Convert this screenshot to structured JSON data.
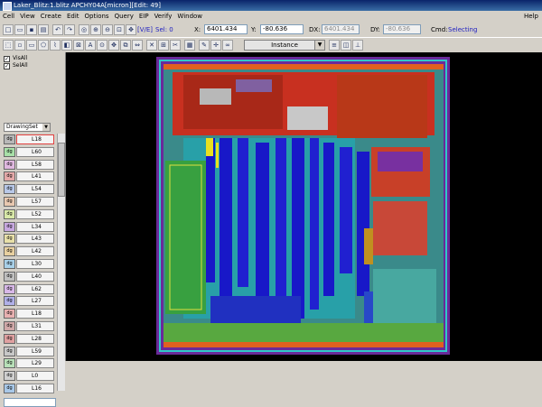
{
  "window": {
    "title": "Laker_Blitz:1.blitz APCHY04A[micron][Edit: 49]"
  },
  "menu": {
    "items": [
      "Cell",
      "View",
      "Create",
      "Edit",
      "Options",
      "Query",
      "EIP",
      "Verify",
      "Window"
    ],
    "help": "Help"
  },
  "toolbar": {
    "ve_label": "[V/E]",
    "sel_label": "Sel: 0",
    "x_label": "X:",
    "x_value": "6401.434",
    "y_label": "Y:",
    "y_value": "-80.636",
    "dx_label": "DX:",
    "dx_value": "6401.434",
    "dy_label": "DY:",
    "dy_value": "-80.636",
    "cmd_label": "Cmd:",
    "cmd_value": "Selecting",
    "instance_select": "Instance"
  },
  "left_panel": {
    "vis_all": "VisAll",
    "sel_all": "SelAll",
    "drawing_set": "DrawingSet",
    "layers": [
      {
        "label": "dg",
        "name": "L18",
        "color": "#b8b8b8"
      },
      {
        "label": "dg",
        "name": "L60",
        "color": "#a8e0a8"
      },
      {
        "label": "dg",
        "name": "L58",
        "color": "#e0b8e0"
      },
      {
        "label": "dg",
        "name": "L41",
        "color": "#e4a8a8"
      },
      {
        "label": "dg",
        "name": "L54",
        "color": "#b8c8e8"
      },
      {
        "label": "dg",
        "name": "L57",
        "color": "#e8c8b0"
      },
      {
        "label": "dg",
        "name": "L52",
        "color": "#d8e8a8"
      },
      {
        "label": "dg",
        "name": "L34",
        "color": "#c8a8e0"
      },
      {
        "label": "dg",
        "name": "L43",
        "color": "#e8e0a8"
      },
      {
        "label": "dg",
        "name": "L42",
        "color": "#e8d0a0"
      },
      {
        "label": "dg",
        "name": "L30",
        "color": "#a8d0e8"
      },
      {
        "label": "dg",
        "name": "L40",
        "color": "#c0c0c0"
      },
      {
        "label": "dg",
        "name": "L62",
        "color": "#d8b8e8"
      },
      {
        "label": "dg",
        "name": "L27",
        "color": "#b0b0e8"
      },
      {
        "label": "dg",
        "name": "L18",
        "color": "#e8b0b0"
      },
      {
        "label": "dg",
        "name": "L31",
        "color": "#d0a8a8"
      },
      {
        "label": "dg",
        "name": "L28",
        "color": "#e0a0a0"
      },
      {
        "label": "dg",
        "name": "L59",
        "color": "#c8c8c8"
      },
      {
        "label": "dg",
        "name": "L29",
        "color": "#b8e0b8"
      },
      {
        "label": "dg",
        "name": "L0",
        "color": "#d0d0d0"
      },
      {
        "label": "dg",
        "name": "L16",
        "color": "#a8c8e8"
      }
    ]
  },
  "icons": {
    "toolbar1": [
      "new-icon",
      "open-icon",
      "save-icon",
      "print-icon",
      "undo-icon",
      "redo-icon",
      "zoom-fit-icon",
      "zoom-in-icon",
      "zoom-out-icon",
      "zoom-area-icon",
      "pan-icon",
      "redraw-icon"
    ],
    "toolbar2": [
      "select-icon",
      "window-icon",
      "rect-icon",
      "polygon-icon",
      "path-icon",
      "instance-icon",
      "via-icon",
      "text-icon",
      "pin-icon",
      "move-icon",
      "copy-icon",
      "stretch-icon",
      "delete-icon",
      "merge-icon",
      "cut-icon",
      "ruler-icon",
      "probe-icon",
      "binocular-icon"
    ]
  },
  "colors": {
    "title_bar": "#0a246a",
    "canvas_bg": "#000000",
    "cmd_text": "#2020c0"
  }
}
